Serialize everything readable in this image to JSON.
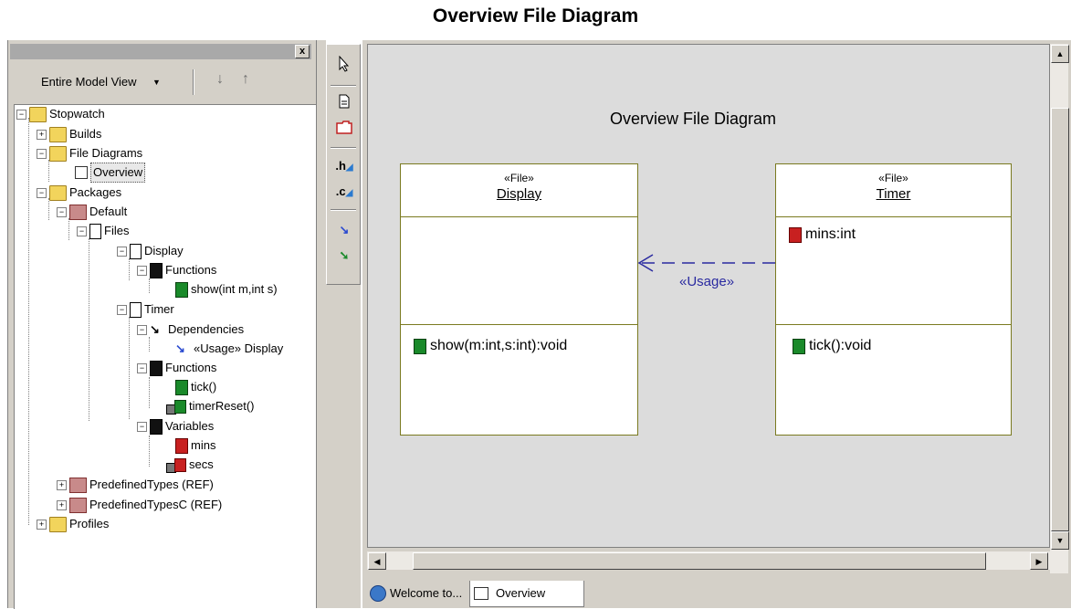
{
  "page_title": "Overview File Diagram",
  "browser": {
    "close_glyph": "x",
    "view_selector": "Entire Model View",
    "view_arrow": "▼",
    "nav_down": "↓",
    "nav_up": "↑",
    "tree": {
      "root": "Stopwatch",
      "builds": "Builds",
      "file_diagrams": "File Diagrams",
      "overview": "Overview",
      "packages": "Packages",
      "default": "Default",
      "files": "Files",
      "display": "Display",
      "display_functions": "Functions",
      "display_show": "show(int m,int s)",
      "timer": "Timer",
      "dependencies": "Dependencies",
      "usage_display": "«Usage» Display",
      "timer_functions": "Functions",
      "tick": "tick()",
      "timer_reset": "timerReset()",
      "variables": "Variables",
      "mins": "mins",
      "secs": "secs",
      "predefined_types": "PredefinedTypes (REF)",
      "predefined_types_c": "PredefinedTypesC (REF)",
      "profiles": "Profiles"
    }
  },
  "diagram_toolbar": {
    "h_tool": ".h",
    "c_tool": ".c"
  },
  "diagram": {
    "title": "Overview File Diagram",
    "display_box": {
      "stereotype": "«File»",
      "name": "Display",
      "operation": "show(m:int,s:int):void"
    },
    "timer_box": {
      "stereotype": "«File»",
      "name": "Timer",
      "attribute": "mins:int",
      "operation": "tick():void"
    },
    "dependency_label": "«Usage»"
  },
  "tabs": {
    "welcome": "Welcome to...",
    "overview": "Overview"
  },
  "scroll": {
    "up": "▲",
    "down": "▼",
    "left": "◀",
    "right": "▶"
  },
  "colors": {
    "function_icon": "#1a8a2a",
    "variable_icon": "#c82020",
    "dependency_line": "#2a2aa0"
  }
}
